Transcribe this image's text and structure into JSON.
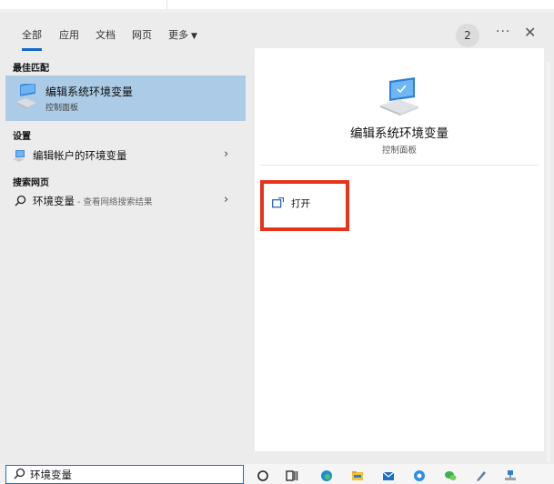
{
  "tabs": [
    {
      "label": "全部"
    },
    {
      "label": "应用"
    },
    {
      "label": "文档"
    },
    {
      "label": "网页"
    },
    {
      "label": "更多"
    }
  ],
  "header": {
    "badge": "2",
    "more_icon": "ellipsis-icon",
    "close_icon": "close-icon"
  },
  "sections": {
    "best_match": "最佳匹配",
    "settings": "设置",
    "web": "搜索网页"
  },
  "best_match": {
    "title": "编辑系统环境变量",
    "subtitle": "控制面板"
  },
  "settings_item": {
    "label": "编辑帐户的环境变量"
  },
  "web_item": {
    "query": "环境变量",
    "suffix": " - 查看网络搜索结果"
  },
  "detail": {
    "title": "编辑系统环境变量",
    "subtitle": "控制面板",
    "open_label": "打开"
  },
  "search": {
    "value": "环境变量"
  },
  "colors": {
    "accent": "#1167c9",
    "selected": "#abcbe6",
    "highlight": "#e8321a"
  }
}
